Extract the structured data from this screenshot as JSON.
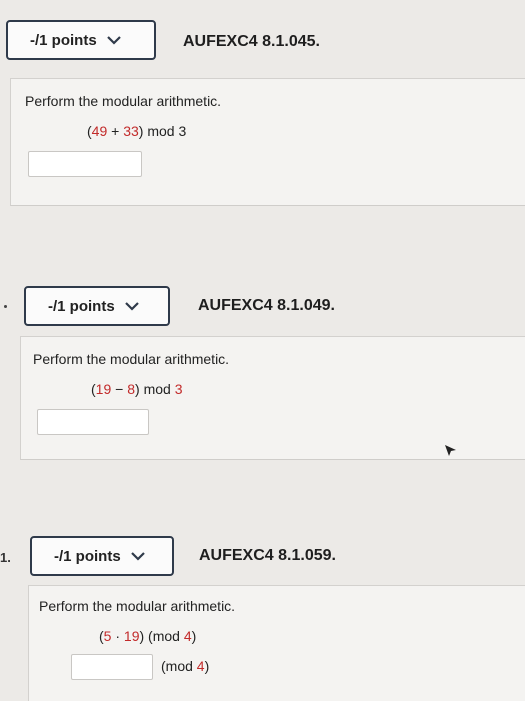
{
  "problems": [
    {
      "points_label": "-/1 points",
      "question_id": "AUFEXC4 8.1.045.",
      "instruction": "Perform the modular arithmetic.",
      "expr": {
        "open": "(",
        "a": "49",
        "op": " + ",
        "b": "33",
        "close": ")",
        "mod": " mod ",
        "m": "3"
      }
    },
    {
      "points_label": "-/1 points",
      "question_id": "AUFEXC4 8.1.049.",
      "instruction": "Perform the modular arithmetic.",
      "expr": {
        "open": "(",
        "a": "19",
        "op": " − ",
        "b": "8",
        "close": ")",
        "mod": " mod ",
        "m": "3"
      }
    },
    {
      "number": "1.",
      "points_label": "-/1 points",
      "question_id": "AUFEXC4 8.1.059.",
      "instruction": "Perform the modular arithmetic.",
      "expr": {
        "open": "(",
        "a": "5",
        "op": " · ",
        "b": "19",
        "close": ")",
        "mod": " (mod ",
        "m": "4",
        "mod_close": ")"
      },
      "answer_suffix": {
        "mod": "(mod ",
        "m": "4",
        "close": ")"
      }
    }
  ]
}
